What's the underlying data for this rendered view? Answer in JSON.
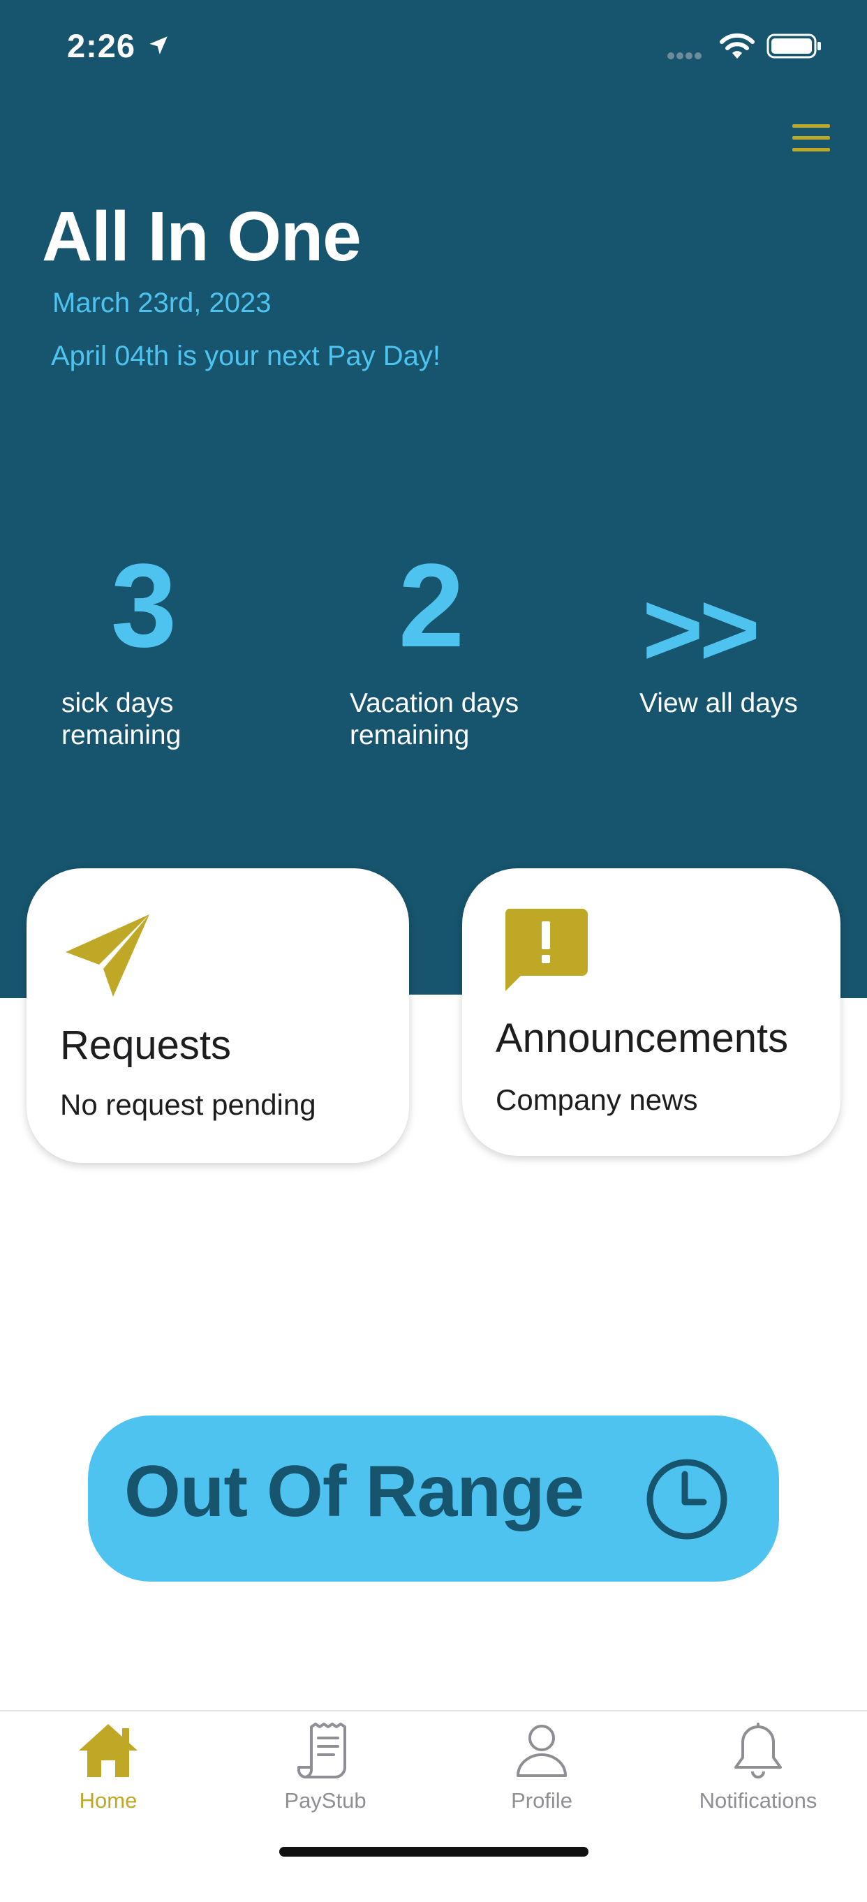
{
  "status_bar": {
    "time": "2:26"
  },
  "header": {
    "title": "All In One",
    "date": "March 23rd, 2023",
    "payday": "April 04th is your next Pay Day!"
  },
  "stats": {
    "sick": {
      "value": "3",
      "label_line1": "sick days",
      "label_line2": "remaining"
    },
    "vacation": {
      "value": "2",
      "label_line1": "Vacation days",
      "label_line2": "remaining"
    },
    "view_all": {
      "symbol": ">>",
      "label": "View all days"
    }
  },
  "cards": {
    "requests": {
      "title": "Requests",
      "subtitle": "No request pending",
      "icon": "paper-plane-icon"
    },
    "announcements": {
      "title": "Announcements",
      "subtitle": "Company news",
      "icon": "alert-message-icon"
    }
  },
  "clock_button": {
    "label": "Out Of Range",
    "icon": "clock-icon"
  },
  "tabbar": {
    "items": [
      {
        "label": "Home",
        "icon": "home-icon",
        "active": true
      },
      {
        "label": "PayStub",
        "icon": "paystub-icon",
        "active": false
      },
      {
        "label": "Profile",
        "icon": "profile-icon",
        "active": false
      },
      {
        "label": "Notifications",
        "icon": "bell-icon",
        "active": false
      }
    ]
  },
  "colors": {
    "header_bg": "#17546d",
    "accent_blue": "#4fc3ef",
    "accent_gold": "#bfa826",
    "inactive_gray": "#8e8e93"
  }
}
